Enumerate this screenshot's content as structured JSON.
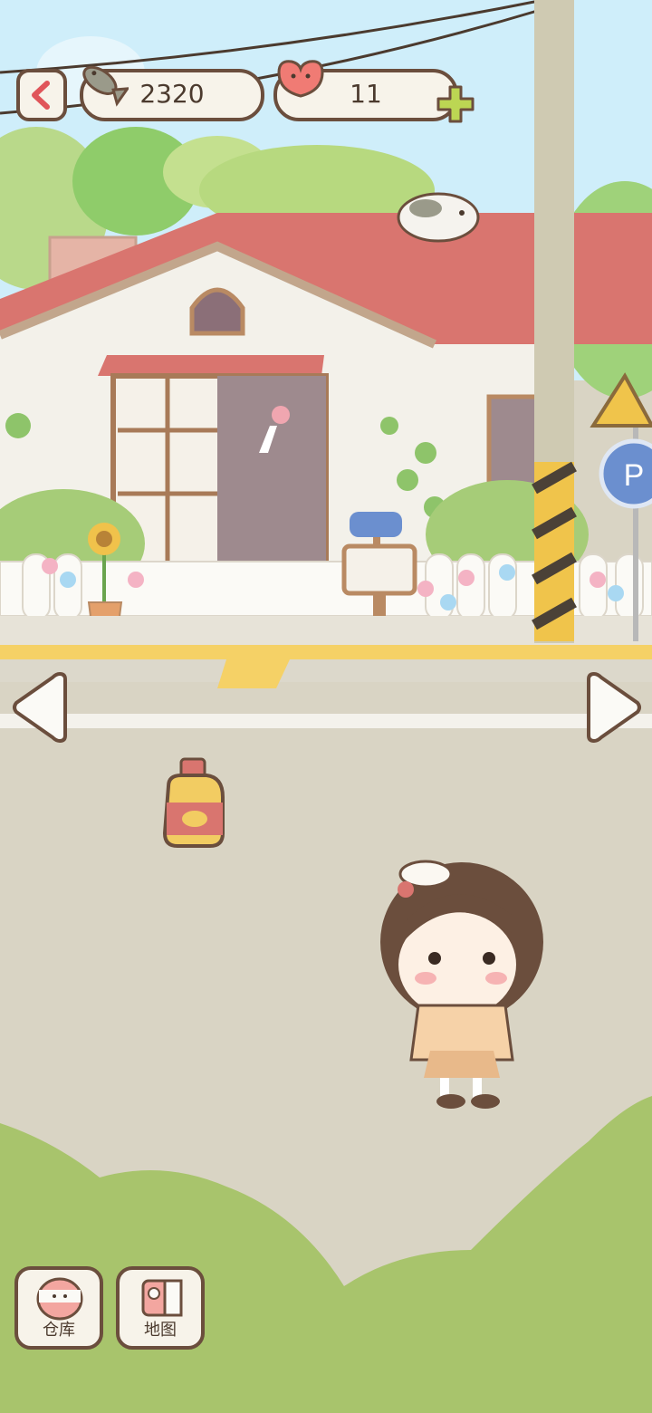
{
  "hud": {
    "back_icon": "chevron-left-icon",
    "fish_icon": "fish-icon",
    "fish_count": "2320",
    "heart_icon": "heart-icon",
    "heart_count": "11",
    "add_icon": "plus-icon"
  },
  "navigation": {
    "left_icon": "arrow-left-icon",
    "right_icon": "arrow-right-icon"
  },
  "bottom_menu": {
    "storage_label": "仓库",
    "storage_icon": "storage-box-icon",
    "map_label": "地图",
    "map_icon": "map-icon"
  },
  "colors": {
    "sky": "#cfeefa",
    "roof": "#d9756f",
    "house_wall": "#f3f1ea",
    "road": "#d9d4c4",
    "grass": "#a8c46c",
    "accent_border": "#6b4e3d"
  }
}
